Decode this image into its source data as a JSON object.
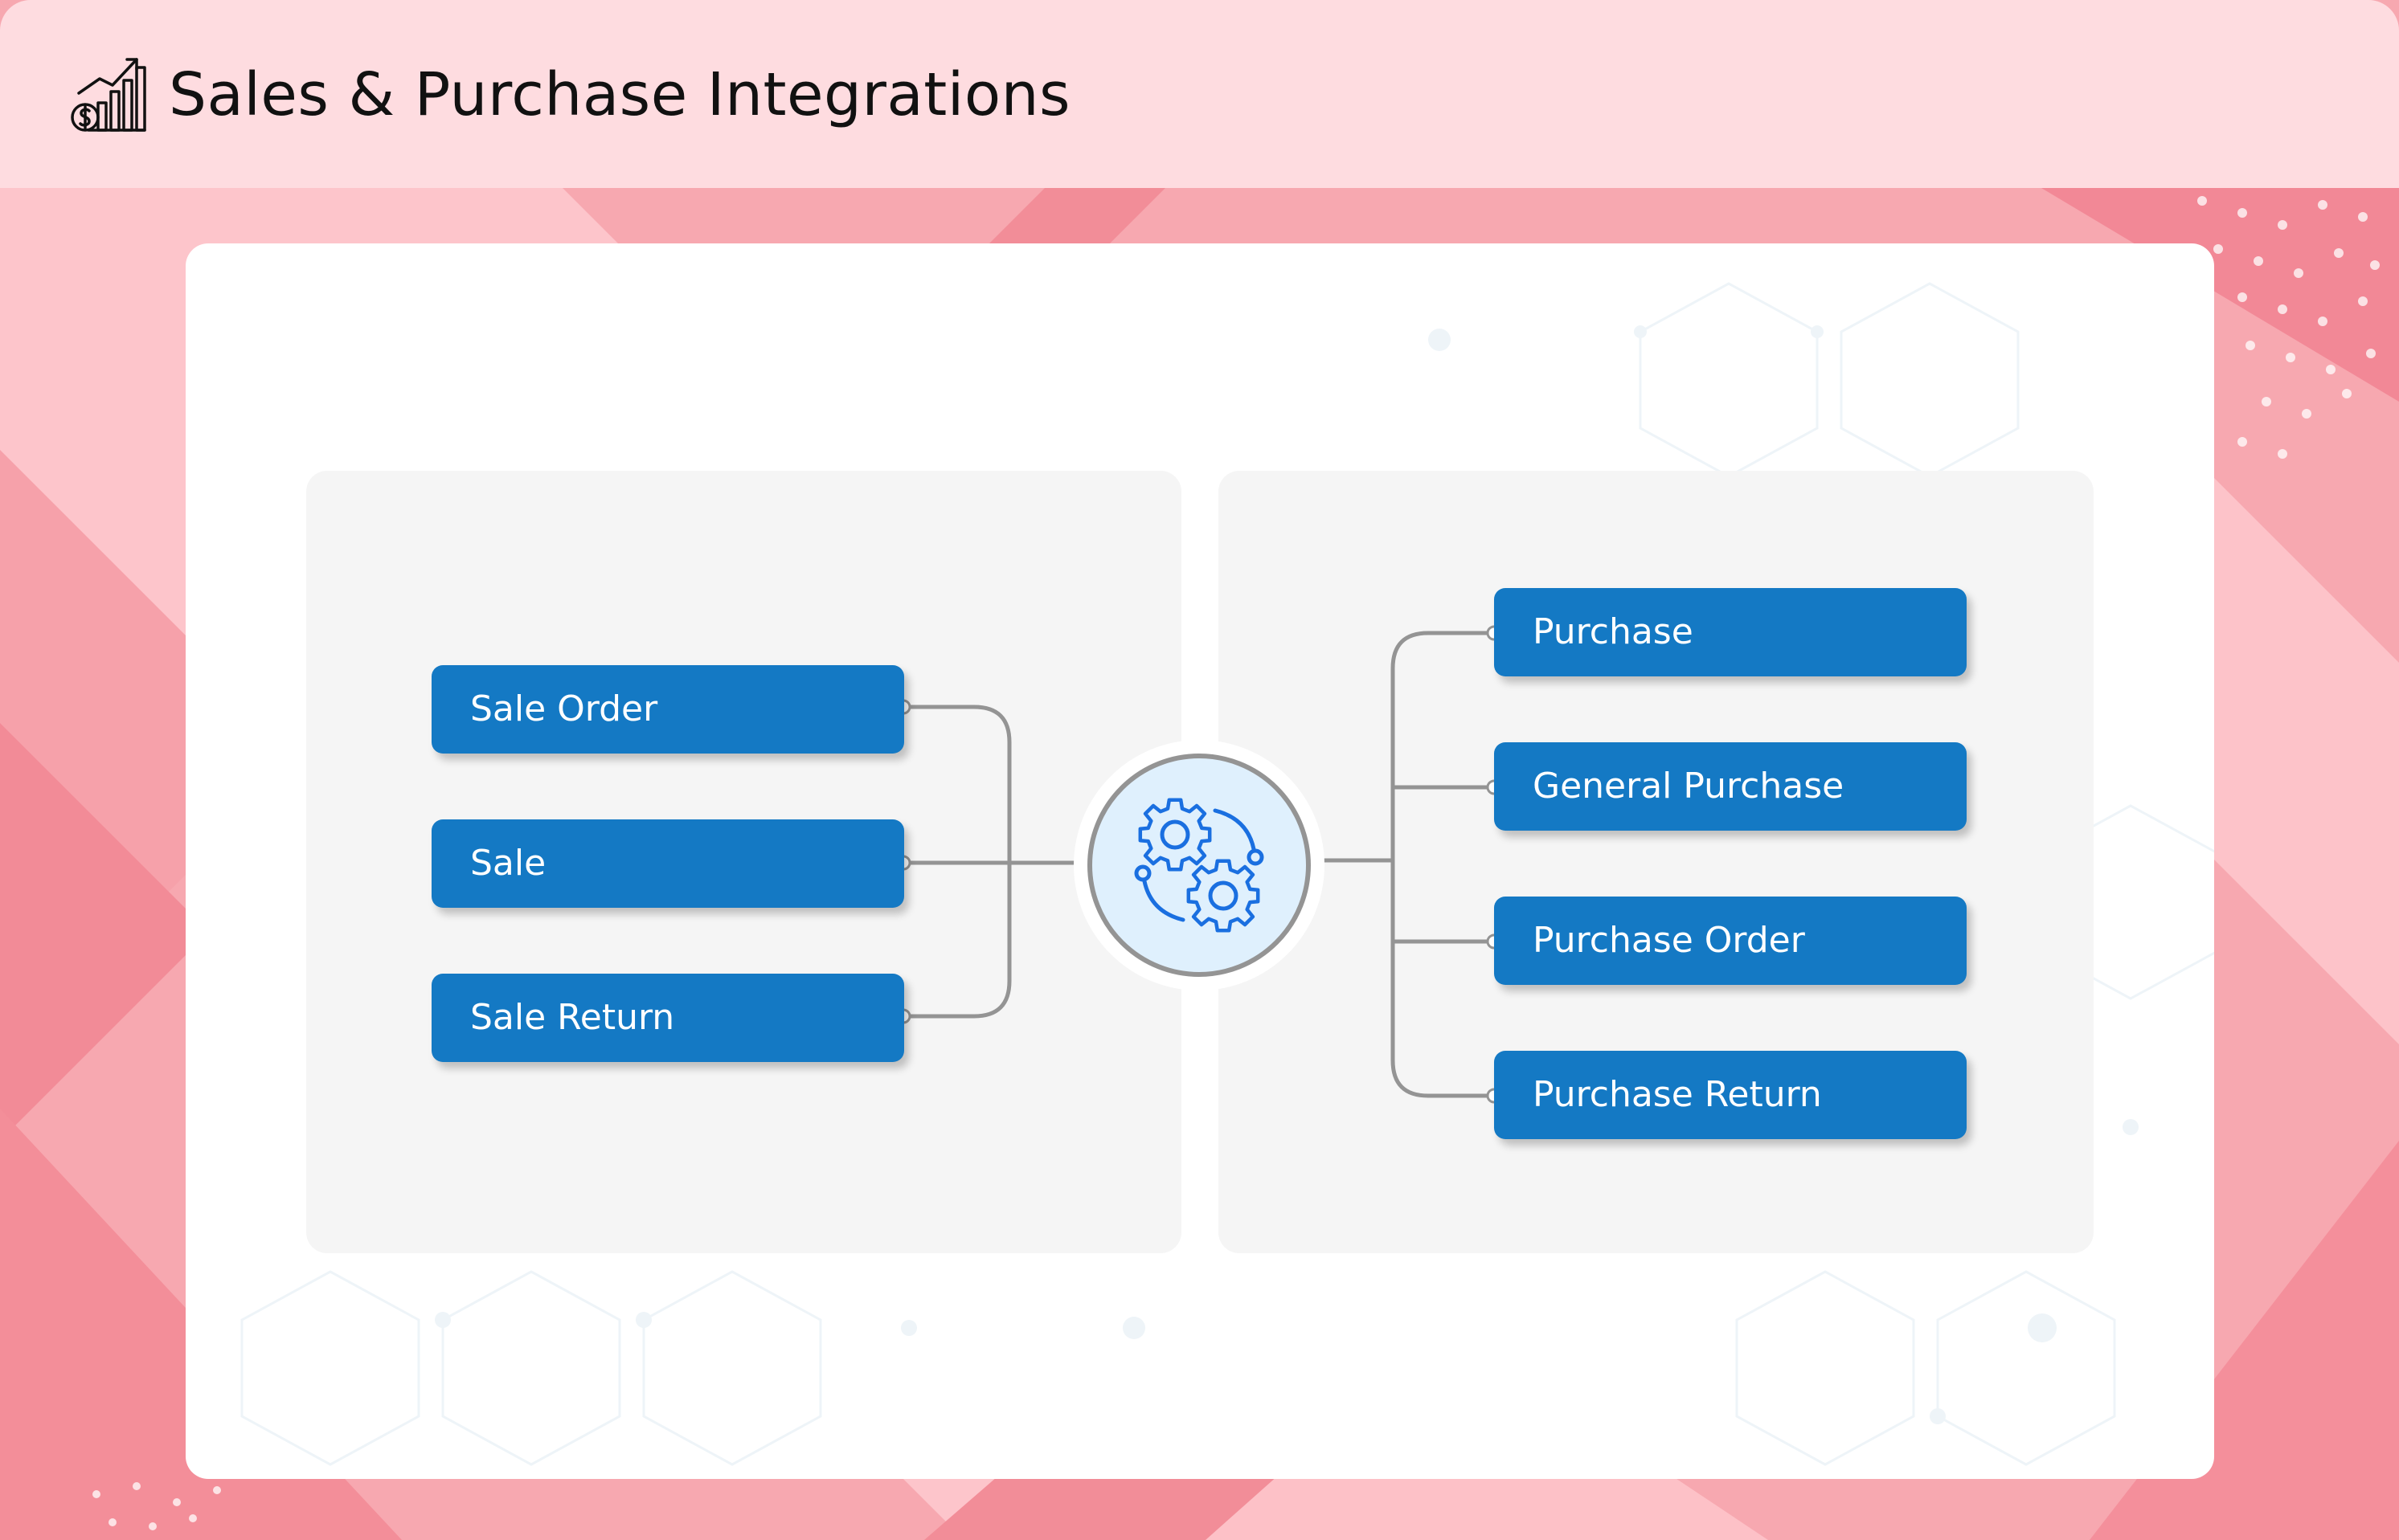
{
  "header": {
    "title": "Sales & Purchase Integrations",
    "icon": "sales-chart-icon"
  },
  "hub": {
    "icon": "gears-icon"
  },
  "sales": {
    "items": [
      {
        "label": "Sale Order"
      },
      {
        "label": "Sale"
      },
      {
        "label": "Sale Return"
      }
    ]
  },
  "purchases": {
    "items": [
      {
        "label": "Purchase"
      },
      {
        "label": "General Purchase"
      },
      {
        "label": "Purchase Order"
      },
      {
        "label": "Purchase Return"
      }
    ]
  },
  "colors": {
    "header_bg": "#fedce0",
    "node_bg": "#1479c4",
    "panel_bg": "#f5f5f5",
    "connector": "#949494",
    "hub_fill": "#dff0fd",
    "gear": "#1a6fe0",
    "pink_light": "#fdc3c9",
    "pink_mid": "#f6a6ae",
    "pink_dark": "#f28d98"
  }
}
